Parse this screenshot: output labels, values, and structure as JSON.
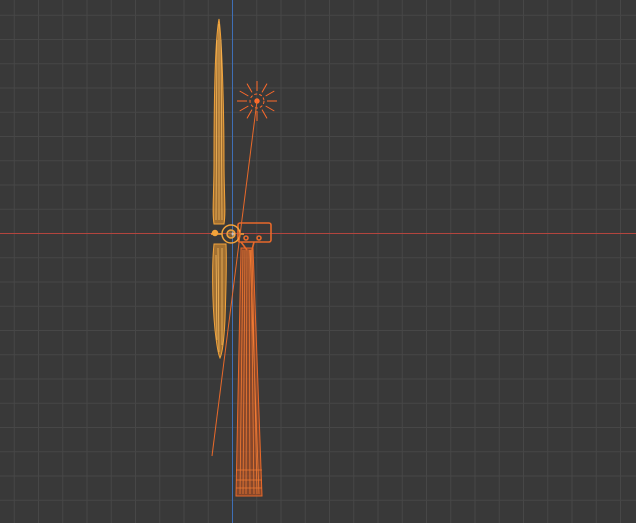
{
  "viewport": {
    "view": "side-orthographic",
    "shading": "wireframe",
    "colors": {
      "background": "#393939",
      "grid_minor": "#474747",
      "grid_major": "#4d4d4d",
      "axis_x": "#b3453e",
      "axis_z": "#3f6fb5",
      "selected_active": "#f2a33a",
      "selected": "#e8692a",
      "light": "#ff6a2a"
    }
  },
  "scene": {
    "objects": [
      {
        "name": "blade-assembly",
        "kind": "mesh",
        "state": "active",
        "color": "#f2a33a"
      },
      {
        "name": "tower-and-nacelle",
        "kind": "mesh",
        "state": "selected",
        "color": "#e8692a"
      },
      {
        "name": "point-light",
        "kind": "light",
        "state": "selected",
        "color": "#ff6a2a"
      }
    ]
  }
}
